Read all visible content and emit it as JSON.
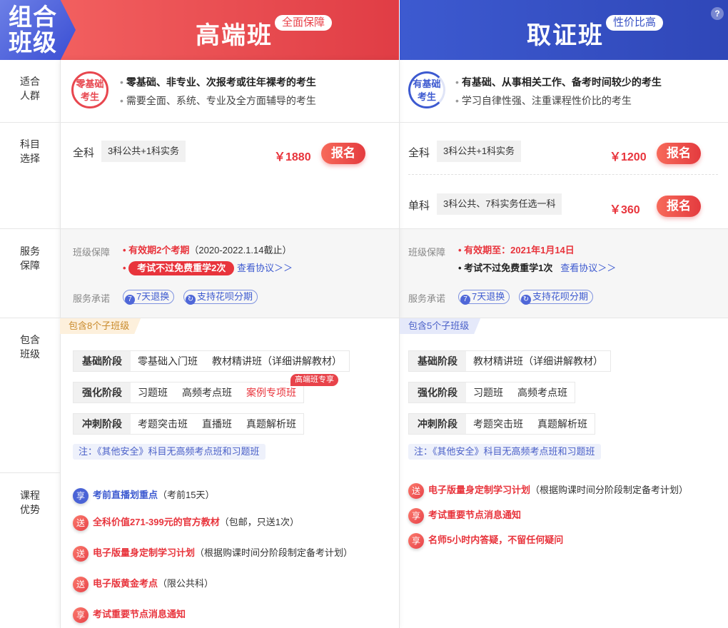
{
  "header": {
    "combo_label_line1": "组合",
    "combo_label_line2": "班级",
    "help_icon": "?",
    "col_a": {
      "title": "高端班",
      "tag": "全面保障"
    },
    "col_b": {
      "title": "取证班",
      "tag": "性价比高"
    }
  },
  "rows": {
    "audience": {
      "line1": "适合",
      "line2": "人群"
    },
    "subjects": {
      "line1": "科目",
      "line2": "选择"
    },
    "service": {
      "line1": "服务",
      "line2": "保障"
    },
    "classes": {
      "line1": "包含",
      "line2": "班级"
    },
    "advantages": {
      "line1": "课程",
      "line2": "优势"
    }
  },
  "audience": {
    "a": {
      "badge_line1": "零基础",
      "badge_line2": "考生",
      "item1": "零基础、非专业、次报考或往年裸考的考生",
      "item2": "需要全面、系统、专业及全方面辅导的考生"
    },
    "b": {
      "badge_line1": "有基础",
      "badge_line2": "考生",
      "item1": "有基础、从事相关工作、备考时间较少的考生",
      "item2": "学习自律性强、注重课程性价比的考生"
    }
  },
  "subjects": {
    "a": [
      {
        "name": "全科",
        "desc": "3科公共+1科实务",
        "price": "￥1880",
        "button": "报名"
      }
    ],
    "b": [
      {
        "name": "全科",
        "desc": "3科公共+1科实务",
        "price": "￥1200",
        "button": "报名"
      },
      {
        "name": "单科",
        "desc": "3科公共、7科实务任选一科",
        "price": "￥360",
        "button": "报名"
      }
    ]
  },
  "service": {
    "guarantee_label": "班级保障",
    "promise_label": "服务承诺",
    "a": {
      "validity": "有效期2个考期",
      "validity_note": "（2020-2022.1.14截止）",
      "retake": "考试不过免费重学2次",
      "agreement": "查看协议＞＞",
      "refund": "7天退换",
      "installment": "支持花呗分期"
    },
    "b": {
      "validity": "有效期至：2021年1月14日",
      "retake": "考试不过免费重学1次",
      "agreement": "查看协议＞＞",
      "refund": "7天退换",
      "installment": "支持花呗分期"
    }
  },
  "classes": {
    "a": {
      "count_tag": "包含8个子班级",
      "stages": [
        {
          "label": "基础阶段",
          "items": [
            "零基础入门班",
            "教材精讲班（详细讲解教材）"
          ]
        },
        {
          "label": "强化阶段",
          "items": [
            "习题班",
            "高频考点班",
            "案例专项班"
          ]
        },
        {
          "label": "冲刺阶段",
          "items": [
            "考题突击班",
            "直播班",
            "真题解析班"
          ]
        }
      ],
      "exclusive_tag": "高端班专享",
      "note": "注：《其他安全》科目无高频考点班和习题班"
    },
    "b": {
      "count_tag": "包含5个子班级",
      "stages": [
        {
          "label": "基础阶段",
          "items": [
            "教材精讲班（详细讲解教材）"
          ]
        },
        {
          "label": "强化阶段",
          "items": [
            "习题班",
            "高频考点班"
          ]
        },
        {
          "label": "冲刺阶段",
          "items": [
            "考题突击班",
            "真题解析班"
          ]
        }
      ],
      "note": "注：《其他安全》科目无高频考点班和习题班"
    }
  },
  "advantages": {
    "a": [
      {
        "badge": "享",
        "color": "blue",
        "highlight": "考前直播划重点",
        "plain": "（考前15天）"
      },
      {
        "badge": "送",
        "color": "red",
        "highlight": "全科价值271-399元的官方教材",
        "plain": "（包邮，只送1次）"
      },
      {
        "badge": "送",
        "color": "red",
        "highlight": "电子版量身定制学习计划",
        "plain": "（根据购课时间分阶段制定备考计划）"
      },
      {
        "badge": "送",
        "color": "red",
        "highlight": "电子版黄金考点",
        "plain": "（限公共科）"
      },
      {
        "badge": "享",
        "color": "red",
        "highlight": "考试重要节点消息通知",
        "plain": ""
      }
    ],
    "b": [
      {
        "badge": "送",
        "color": "red",
        "highlight": "电子版量身定制学习计划",
        "plain": "（根据购课时间分阶段制定备考计划）"
      },
      {
        "badge": "享",
        "color": "red",
        "highlight": "考试重要节点消息通知",
        "plain": ""
      },
      {
        "badge": "享",
        "color": "red",
        "highlight": "名师5小时内答疑，不留任何疑问",
        "plain": ""
      }
    ]
  },
  "colors": {
    "red": "#e8343c",
    "blue": "#3d5ad0",
    "header_red": "#e8474f",
    "header_blue": "#3a53c6"
  }
}
